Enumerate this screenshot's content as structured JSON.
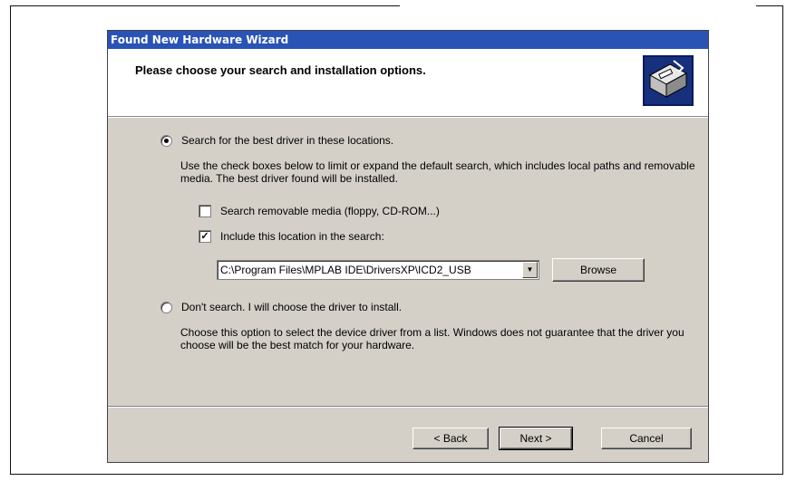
{
  "window": {
    "title": "Found New Hardware Wizard"
  },
  "header": {
    "title": "Please choose your search and installation options.",
    "icon": "hardware-wizard-icon"
  },
  "options": {
    "search": {
      "label": "Search for the best driver in these locations.",
      "selected": true,
      "description": "Use the check boxes below to limit or expand the default search, which includes local paths and removable media. The best driver found will be installed.",
      "removable_media": {
        "label": "Search removable media (floppy, CD-ROM...)",
        "checked": false
      },
      "include_location": {
        "label": "Include this location in the search:",
        "checked": true
      },
      "location_value": "C:\\Program Files\\MPLAB IDE\\DriversXP\\ICD2_USB",
      "browse_label": "Browse"
    },
    "dont_search": {
      "label": "Don't search. I will choose the driver to install.",
      "selected": false,
      "description": "Choose this option to select the device driver from a list. Windows does not guarantee that the driver you choose will be the best match for your hardware."
    }
  },
  "footer": {
    "back_label": "< Back",
    "next_label": "Next >",
    "cancel_label": "Cancel"
  },
  "colors": {
    "titlebar": "#2a53b6",
    "dialog_bg": "#d4d0c8"
  }
}
